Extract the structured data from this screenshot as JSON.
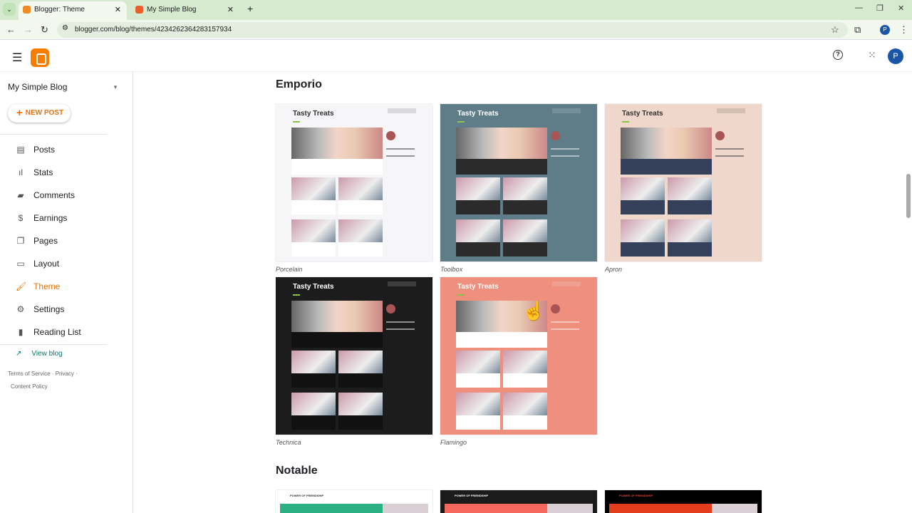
{
  "browser": {
    "tabs": [
      {
        "title": "Blogger: Theme"
      },
      {
        "title": "My Simple Blog"
      }
    ],
    "url": "blogger.com/blog/themes/4234262364283157934",
    "profile": "P"
  },
  "sidebar": {
    "blog_name": "My Simple Blog",
    "new_post": "NEW POST",
    "items": [
      {
        "label": "Posts",
        "icon": "▤"
      },
      {
        "label": "Stats",
        "icon": "ıl"
      },
      {
        "label": "Comments",
        "icon": "▰"
      },
      {
        "label": "Earnings",
        "icon": "$"
      },
      {
        "label": "Pages",
        "icon": "❐"
      },
      {
        "label": "Layout",
        "icon": "▭"
      },
      {
        "label": "Theme",
        "icon": "🖌"
      },
      {
        "label": "Settings",
        "icon": "⚙"
      },
      {
        "label": "Reading List",
        "icon": "▮"
      }
    ],
    "view_blog": "View blog",
    "footer": {
      "terms": "Terms of Service",
      "privacy": "Privacy",
      "content_policy": "Content Policy"
    },
    "active": "Theme"
  },
  "sections": [
    {
      "title": "Emporio",
      "themes": [
        {
          "name": "Porcelain",
          "blog_title": "Tasty Treats",
          "bg": "#f6f5f8",
          "fg": "#333",
          "card": "#ffffff",
          "side": "#f6f5f8"
        },
        {
          "name": "Toolbox",
          "blog_title": "Tasty Treats",
          "bg": "#5e7d89",
          "fg": "#fff",
          "card": "#2b2b2b",
          "side": "#5e7d89"
        },
        {
          "name": "Apron",
          "blog_title": "Tasty Treats",
          "bg": "#efd8cb",
          "fg": "#333",
          "card": "#35415a",
          "side": "#efd8cb"
        },
        {
          "name": "Technica",
          "blog_title": "Tasty Treats",
          "bg": "#1c1c1c",
          "fg": "#fff",
          "card": "#111111",
          "side": "#1c1c1c"
        },
        {
          "name": "Flamingo",
          "blog_title": "Tasty Treats",
          "bg": "#ef8f7d",
          "fg": "#fff",
          "card": "#ffffff",
          "side": "#ef8f7d"
        }
      ]
    },
    {
      "title": "Notable",
      "themes": [
        {
          "blog_title": "POWER OF FRIENDSHIP",
          "bg": "#ffffff",
          "fg": "#333",
          "accent": "#2bb083"
        },
        {
          "blog_title": "POWER OF FRIENDSHIP",
          "bg": "#1b1b1b",
          "fg": "#fff",
          "accent": "#f4675d"
        },
        {
          "blog_title": "POWER OF FRIENDSHIP",
          "bg": "#000000",
          "fg": "#e0463a",
          "accent": "#e43d1e"
        }
      ]
    }
  ]
}
